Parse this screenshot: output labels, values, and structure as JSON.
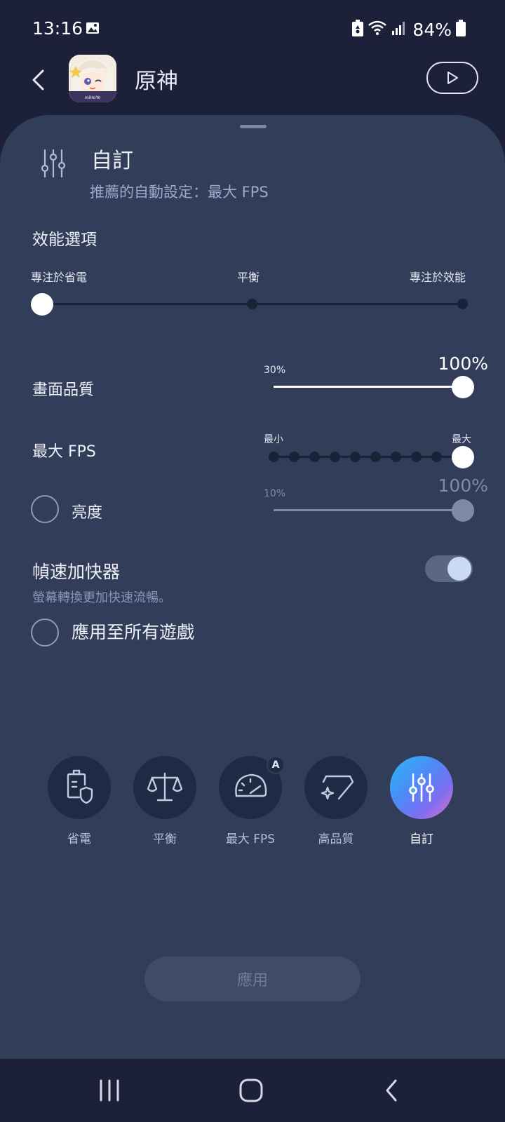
{
  "status_bar": {
    "time": "13:16",
    "battery_percent": "84%",
    "icons": [
      "image-icon",
      "battery-saver-icon",
      "wifi-icon",
      "signal-icon",
      "battery-icon"
    ]
  },
  "app_bar": {
    "title": "原神",
    "icon_caption": "miHoYo"
  },
  "mode_header": {
    "title": "自訂",
    "subtitle": "推薦的自動設定：最大 FPS"
  },
  "performance": {
    "title": "效能選項",
    "labels": [
      "專注於省電",
      "平衡",
      "專注於效能"
    ],
    "selected_index": 0
  },
  "picture_quality": {
    "label": "畫面品質",
    "min_label": "30%",
    "value_label": "100%",
    "value_fraction": 1.0
  },
  "max_fps": {
    "label": "最大 FPS",
    "min_label": "最小",
    "max_label": "最大",
    "steps": 10,
    "selected_step": 10
  },
  "brightness": {
    "label": "亮度",
    "min_label": "10%",
    "value_label": "100%",
    "enabled": false
  },
  "frame_booster": {
    "title": "幀速加快器",
    "subtitle": "螢幕轉換更加快速流暢。",
    "on": true
  },
  "apply_all": {
    "label": "應用至所有遊戲",
    "checked": false
  },
  "modes": [
    {
      "label": "省電",
      "icon": "battery-shield-icon",
      "active": false
    },
    {
      "label": "平衡",
      "icon": "balance-scale-icon",
      "active": false
    },
    {
      "label": "最大 FPS",
      "icon": "speedometer-icon",
      "active": false,
      "badge": "A"
    },
    {
      "label": "高品質",
      "icon": "diamond-sparkle-icon",
      "active": false
    },
    {
      "label": "自訂",
      "icon": "sliders-icon",
      "active": true
    }
  ],
  "apply_button": {
    "label": "應用",
    "enabled": false
  },
  "colors": {
    "background": "#1c2039",
    "sheet": "#323d5a",
    "accent_gradient": [
      "#2bb9f2",
      "#7c6ff2",
      "#e06fc1"
    ]
  }
}
